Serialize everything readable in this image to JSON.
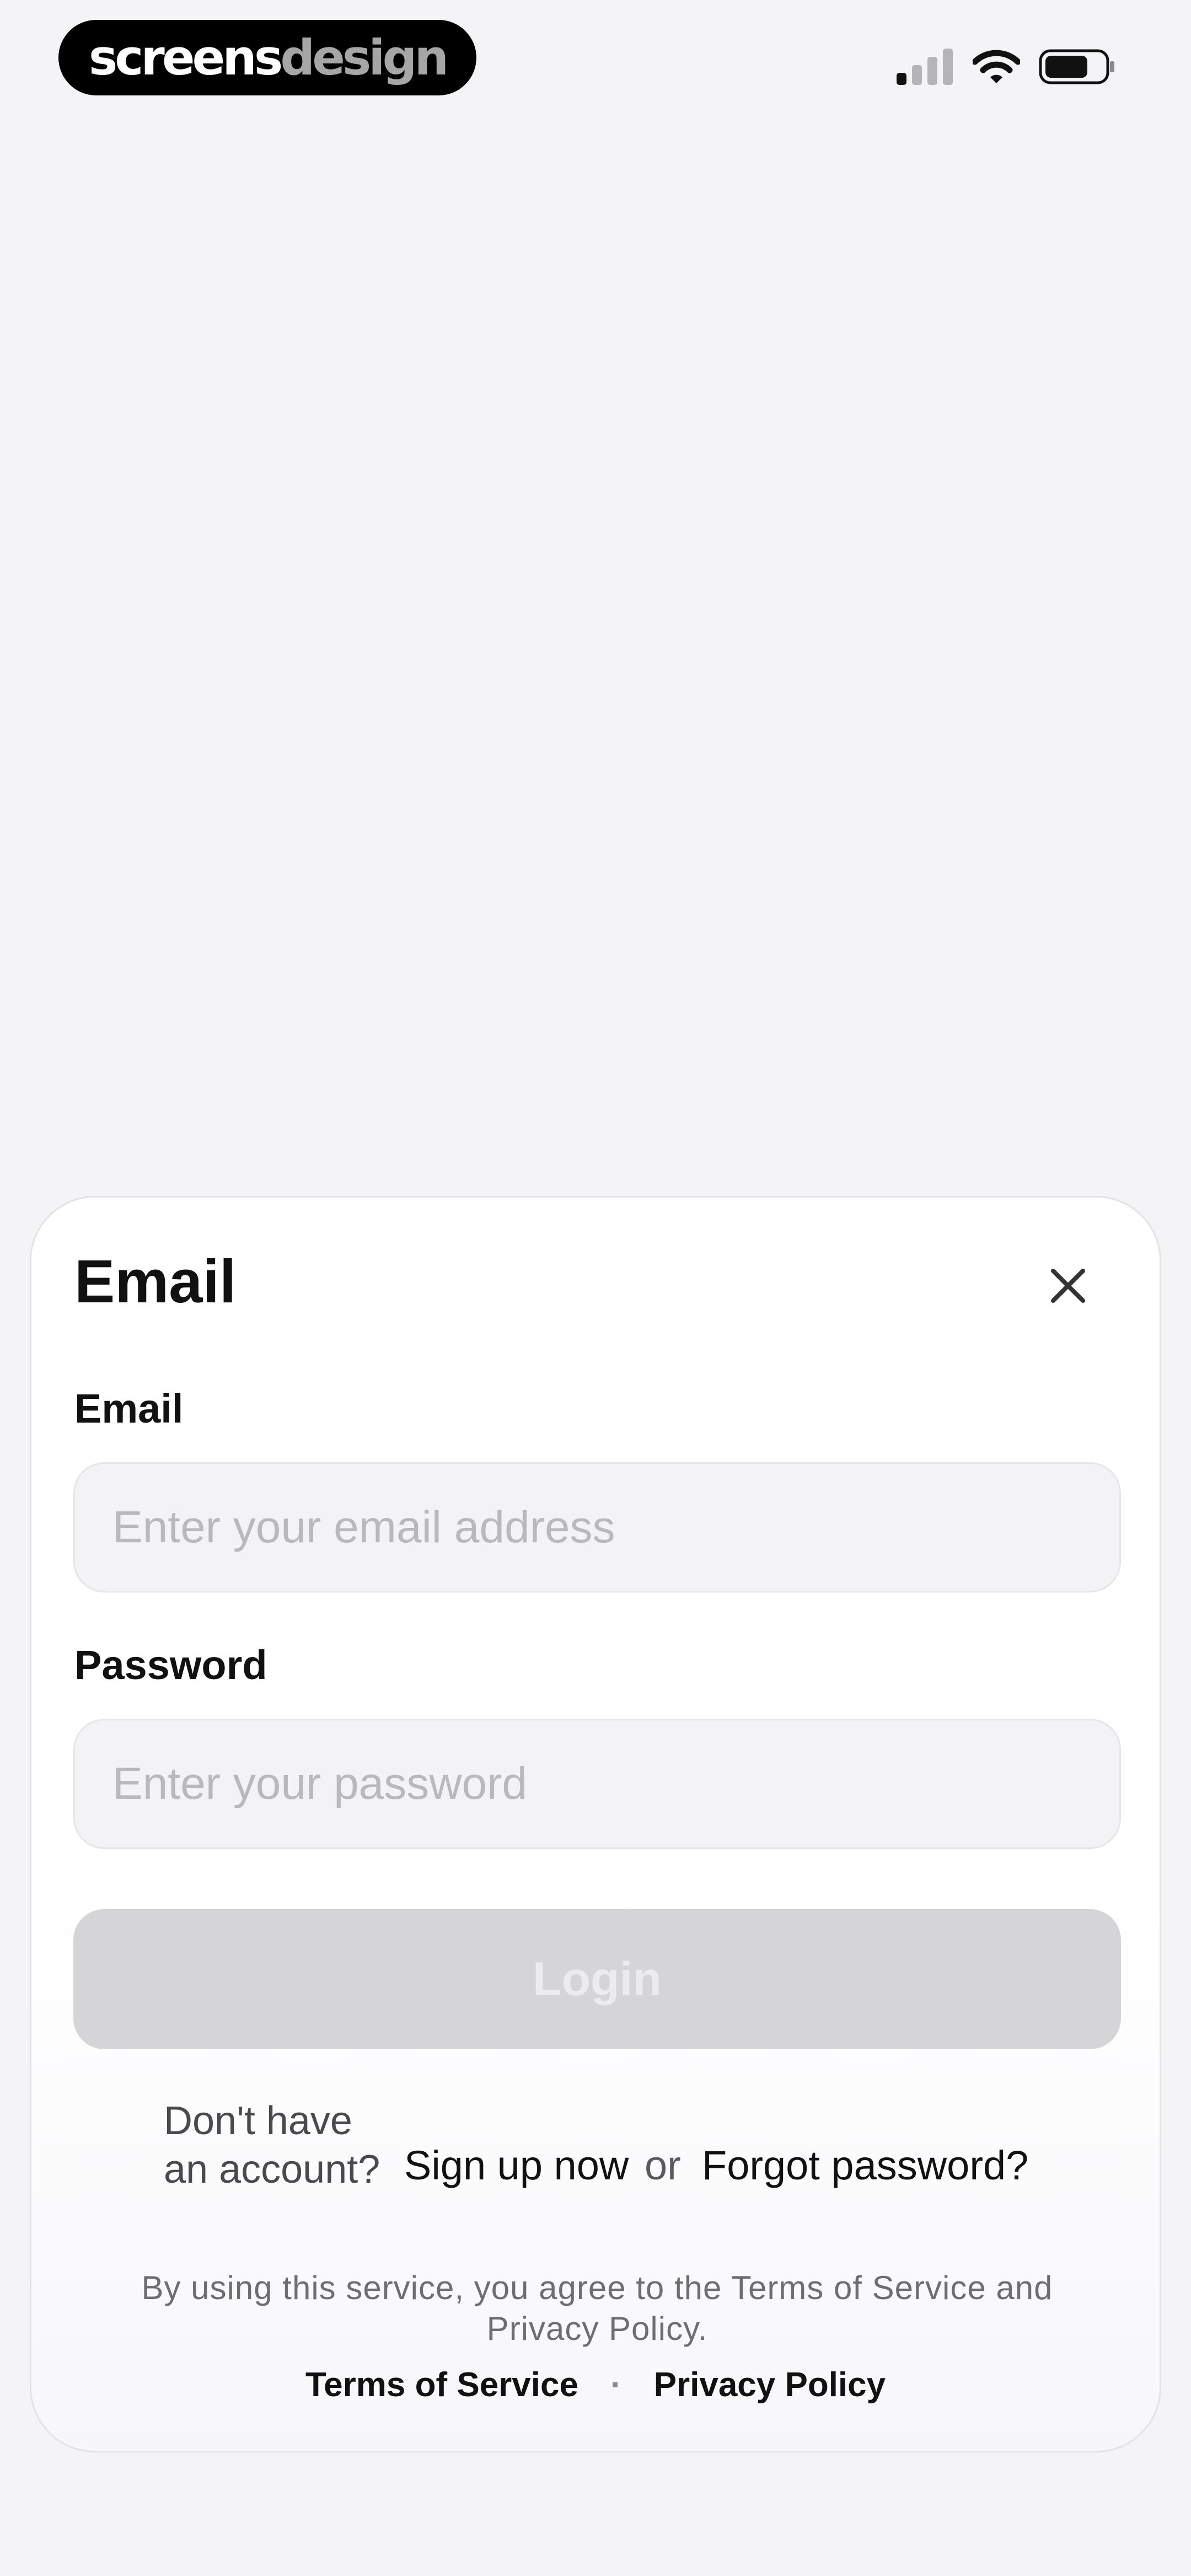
{
  "status_bar": {
    "logo_part1": "screens",
    "logo_part2": "design",
    "icons": [
      "signal-icon",
      "wifi-icon",
      "battery-icon"
    ]
  },
  "sheet": {
    "title": "Email",
    "close_icon": "close-icon",
    "email": {
      "label": "Email",
      "placeholder": "Enter your email address",
      "value": ""
    },
    "password": {
      "label": "Password",
      "placeholder": "Enter your password",
      "value": ""
    },
    "login_label": "Login",
    "account_prompt_line1": "Don't have",
    "account_prompt_line2": "an account?",
    "signup_label": "Sign up now",
    "or_label": "or",
    "forgot_label": "Forgot password?",
    "legal_line1": "By using this service, you agree to the Terms of Service and",
    "legal_line2": "Privacy Policy.",
    "terms_label": "Terms of Service",
    "separator": "·",
    "privacy_label": "Privacy Policy"
  },
  "colors": {
    "background": "#f4f4f7",
    "input_fill": "#f3f3f5",
    "button_disabled": "#d5d5d7",
    "text_primary": "#111111"
  }
}
